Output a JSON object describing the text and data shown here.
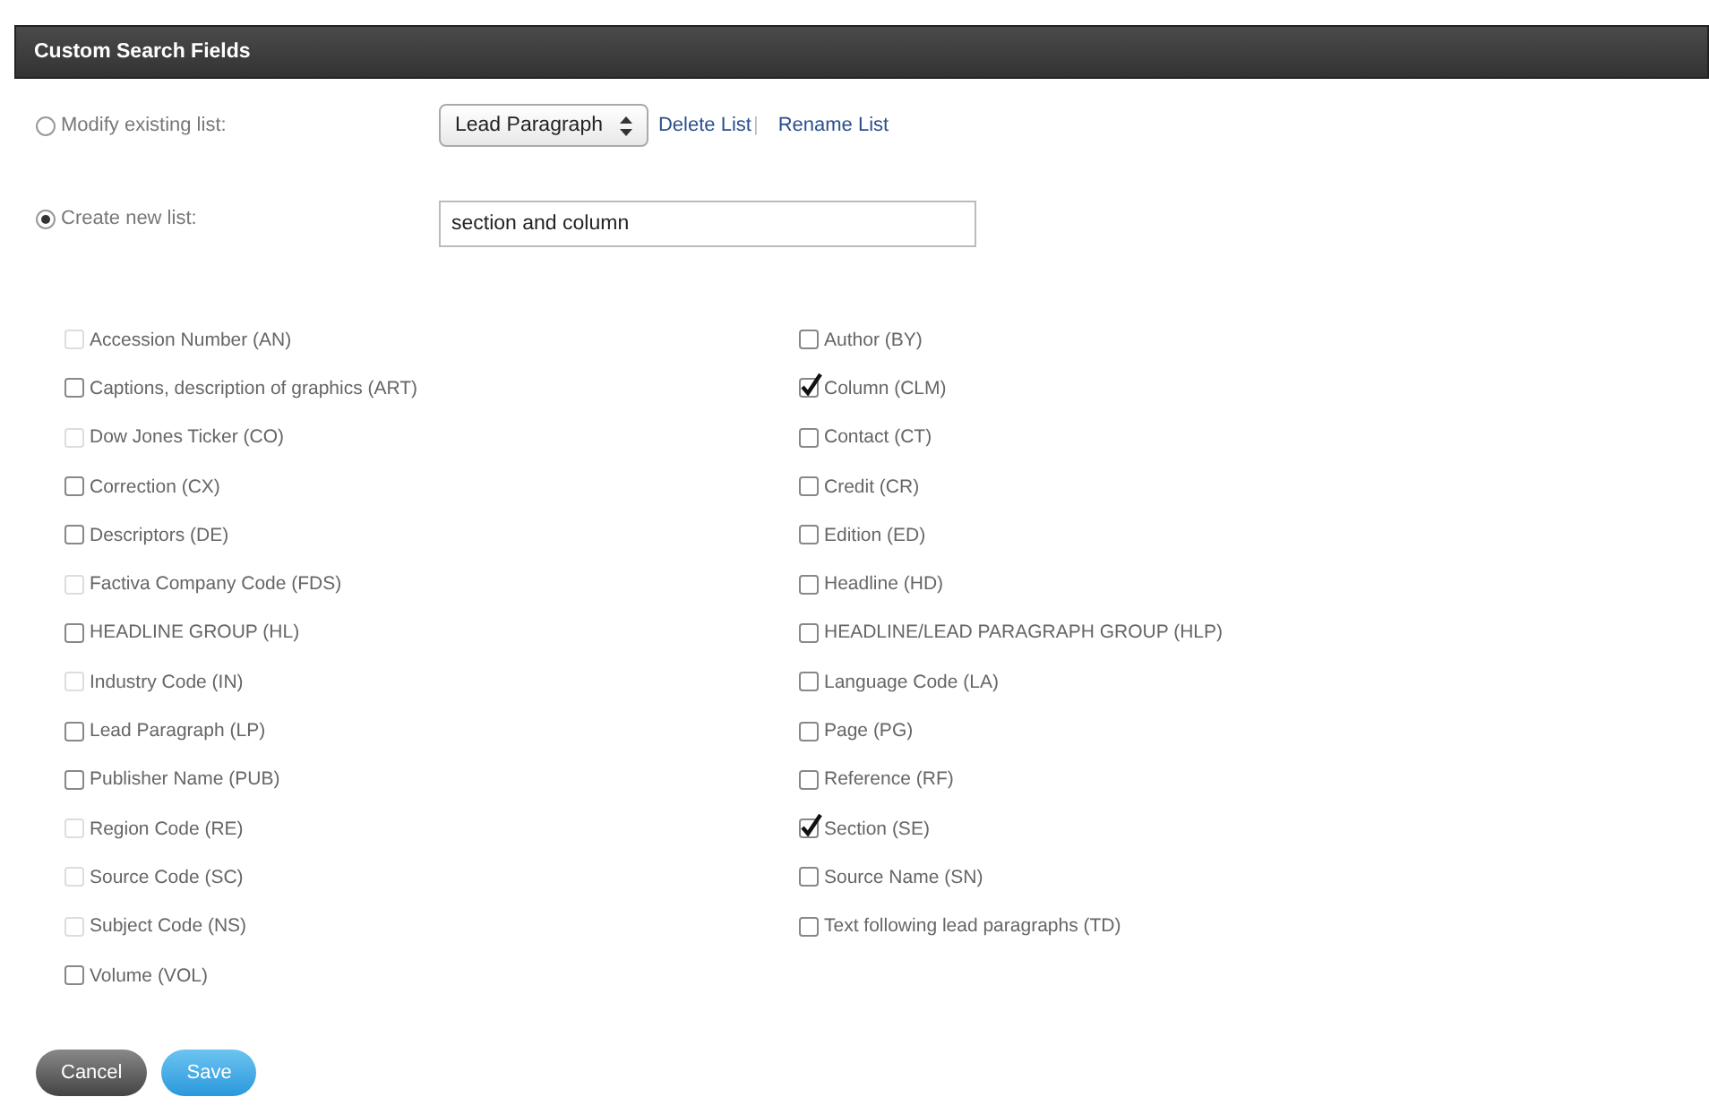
{
  "panel": {
    "title": "Custom Search Fields"
  },
  "modes": [
    {
      "label": "Modify existing list:",
      "selected": false,
      "kind": "select",
      "value": "Lead Paragraph",
      "links": [
        "Delete List",
        "Rename List"
      ],
      "separator": "|"
    },
    {
      "label": "Create new list:",
      "selected": true,
      "kind": "text",
      "value": "section and column"
    }
  ],
  "columns": [
    [
      {
        "label": "Accession Number (AN)",
        "checked": false,
        "disabled": true
      },
      {
        "label": "Captions, description of graphics (ART)",
        "checked": false,
        "disabled": false
      },
      {
        "label": "Dow Jones Ticker (CO)",
        "checked": false,
        "disabled": true
      },
      {
        "label": "Correction (CX)",
        "checked": false,
        "disabled": false
      },
      {
        "label": "Descriptors (DE)",
        "checked": false,
        "disabled": false
      },
      {
        "label": "Factiva Company Code (FDS)",
        "checked": false,
        "disabled": true
      },
      {
        "label": "HEADLINE GROUP (HL)",
        "checked": false,
        "disabled": false
      },
      {
        "label": "Industry Code (IN)",
        "checked": false,
        "disabled": true
      },
      {
        "label": "Lead Paragraph (LP)",
        "checked": false,
        "disabled": false
      },
      {
        "label": "Publisher Name (PUB)",
        "checked": false,
        "disabled": false
      },
      {
        "label": "Region Code (RE)",
        "checked": false,
        "disabled": true
      },
      {
        "label": "Source Code (SC)",
        "checked": false,
        "disabled": true
      },
      {
        "label": "Subject Code (NS)",
        "checked": false,
        "disabled": true
      },
      {
        "label": "Volume (VOL)",
        "checked": false,
        "disabled": false
      }
    ],
    [
      {
        "label": "Author (BY)",
        "checked": false,
        "disabled": false
      },
      {
        "label": "Column (CLM)",
        "checked": true,
        "disabled": false
      },
      {
        "label": "Contact (CT)",
        "checked": false,
        "disabled": false
      },
      {
        "label": "Credit (CR)",
        "checked": false,
        "disabled": false
      },
      {
        "label": "Edition (ED)",
        "checked": false,
        "disabled": false
      },
      {
        "label": "Headline (HD)",
        "checked": false,
        "disabled": false
      },
      {
        "label": "HEADLINE/LEAD PARAGRAPH GROUP (HLP)",
        "checked": false,
        "disabled": false
      },
      {
        "label": "Language Code (LA)",
        "checked": false,
        "disabled": false
      },
      {
        "label": "Page (PG)",
        "checked": false,
        "disabled": false
      },
      {
        "label": "Reference (RF)",
        "checked": false,
        "disabled": false
      },
      {
        "label": "Section (SE)",
        "checked": true,
        "disabled": false
      },
      {
        "label": "Source Name (SN)",
        "checked": false,
        "disabled": false
      },
      {
        "label": "Text following lead paragraphs (TD)",
        "checked": false,
        "disabled": false
      }
    ]
  ],
  "buttons": [
    {
      "label": "Cancel",
      "kind": "secondary"
    },
    {
      "label": "Save",
      "kind": "primary"
    }
  ]
}
